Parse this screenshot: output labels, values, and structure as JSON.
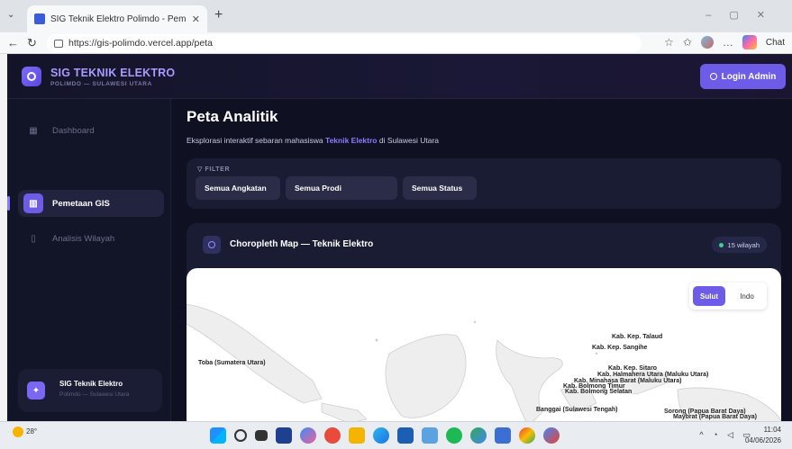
{
  "browser": {
    "tab_title": "SIG Teknik Elektro Polimdo - Pem",
    "url": "https://gis-polimdo.vercel.app/peta",
    "chat_label": "Chat"
  },
  "app": {
    "brand_title": "SIG TEKNIK ELEKTRO",
    "brand_sub": "POLIMDO — SULAWESI UTARA",
    "login_label": "Login Admin"
  },
  "sidebar": {
    "items": [
      {
        "label": "Dashboard",
        "icon": "grid-icon"
      },
      {
        "label": "Pemetaan GIS",
        "icon": "map-icon"
      },
      {
        "label": "Analisis Wilayah",
        "icon": "chart-icon"
      }
    ],
    "footer_title": "SIG Teknik Elektro",
    "footer_sub": "Polimdo — Sulawesi Utara"
  },
  "main": {
    "title": "Peta Analitik",
    "subtitle_pre": "Eksplorasi interaktif sebaran mahasiswa ",
    "subtitle_hl": "Teknik Elektro",
    "subtitle_post": " di Sulawesi Utara",
    "filter_label": "FILTER",
    "filters": [
      "Semua Angkatan",
      "Semua Prodi",
      "Semua Status"
    ],
    "map_title": "Choropleth Map — Teknik Elektro",
    "wilayah_badge": "15 wilayah",
    "toggle": {
      "sulut": "Sulut",
      "indo": "Indo"
    },
    "map_labels": [
      "Kab. Kep. Talaud",
      "Kab. Kep. Sangihe",
      "Toba (Sumatera Utara)",
      "Kab. Kep. Sitaro",
      "Kab. Halmahera Utara (Maluku Utara)",
      "Kab. Minahasa Barat (Maluku Utara)",
      "Kab. Bolmong Timur",
      "Kab. Bolmong Selatan",
      "Banggai (Sulawesi Tengah)",
      "Sorong (Papua Barat Daya)",
      "Maybrat (Papua Barat Daya)"
    ]
  },
  "taskbar": {
    "temp": "28°",
    "time": "11:04",
    "date": "04/06/2026"
  }
}
